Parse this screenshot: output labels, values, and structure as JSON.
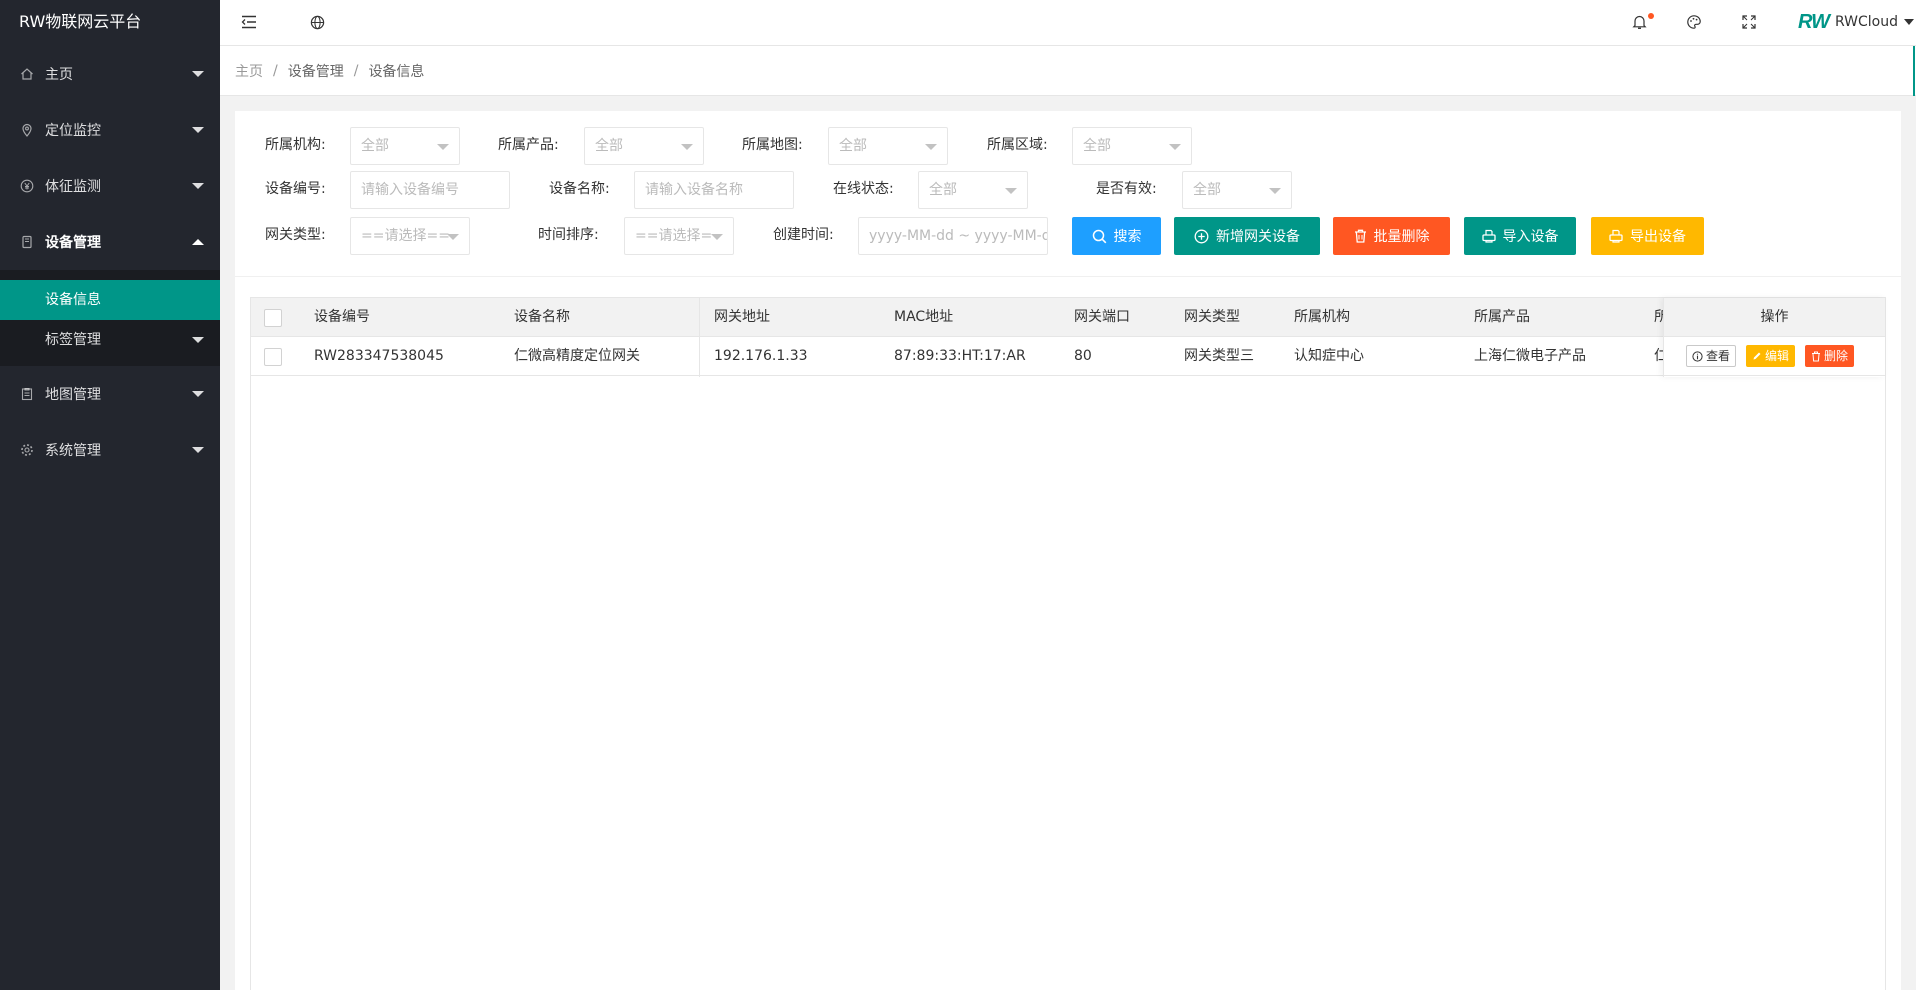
{
  "app": {
    "title": "RW物联网云平台"
  },
  "sidebar": {
    "items": [
      {
        "label": "主页",
        "icon": "home-icon"
      },
      {
        "label": "定位监控",
        "icon": "location-pin-icon"
      },
      {
        "label": "体征监测",
        "icon": "yen-icon"
      },
      {
        "label": "设备管理",
        "icon": "device-icon",
        "expanded": true,
        "children": [
          {
            "label": "设备信息",
            "active": true
          },
          {
            "label": "标签管理"
          }
        ]
      },
      {
        "label": "地图管理",
        "icon": "clipboard-icon"
      },
      {
        "label": "系统管理",
        "icon": "gear-icon"
      }
    ]
  },
  "header": {
    "icons": [
      "menu-fold-icon",
      "globe-icon",
      "bell-icon",
      "theme-palette-icon",
      "fullscreen-icon"
    ],
    "user": {
      "logo": "RW",
      "name": "RWCloud"
    }
  },
  "breadcrumb": [
    "主页",
    "设备管理",
    "设备信息"
  ],
  "filters": {
    "org": {
      "label": "所属机构:",
      "value": "全部"
    },
    "product": {
      "label": "所属产品:",
      "value": "全部"
    },
    "map": {
      "label": "所属地图:",
      "value": "全部"
    },
    "region": {
      "label": "所属区域:",
      "value": "全部"
    },
    "device_no": {
      "label": "设备编号:",
      "placeholder": "请输入设备编号"
    },
    "device_name": {
      "label": "设备名称:",
      "placeholder": "请输入设备名称"
    },
    "online": {
      "label": "在线状态:",
      "value": "全部"
    },
    "valid": {
      "label": "是否有效:",
      "value": "全部"
    },
    "gateway_type": {
      "label": "网关类型:",
      "value": "==请选择=="
    },
    "time_sort": {
      "label": "时间排序:",
      "value": "==请选择="
    },
    "created": {
      "label": "创建时间:",
      "placeholder": "yyyy-MM-dd ~ yyyy-MM-dd"
    }
  },
  "buttons": {
    "search": "搜索",
    "add_gateway": "新增网关设备",
    "batch_delete": "批量删除",
    "import": "导入设备",
    "export": "导出设备"
  },
  "colors": {
    "primary": "#009688",
    "blue": "#1e9fff",
    "red": "#ff5722",
    "yellow": "#ffb800",
    "sidebar": "#23262e"
  },
  "table": {
    "columns": [
      "设备编号",
      "设备名称",
      "网关地址",
      "MAC地址",
      "网关端口",
      "网关类型",
      "所属机构",
      "所属产品",
      "所"
    ],
    "action_header": "操作",
    "rows": [
      {
        "cells": [
          "RW283347538045",
          "仁微高精度定位网关",
          "192.176.1.33",
          "87:89:33:HT:17:AR",
          "80",
          "网关类型三",
          "认知症中心",
          "上海仁微电子产品",
          "仁"
        ]
      }
    ],
    "actions": {
      "view": "查看",
      "edit": "编辑",
      "delete": "删除"
    }
  }
}
